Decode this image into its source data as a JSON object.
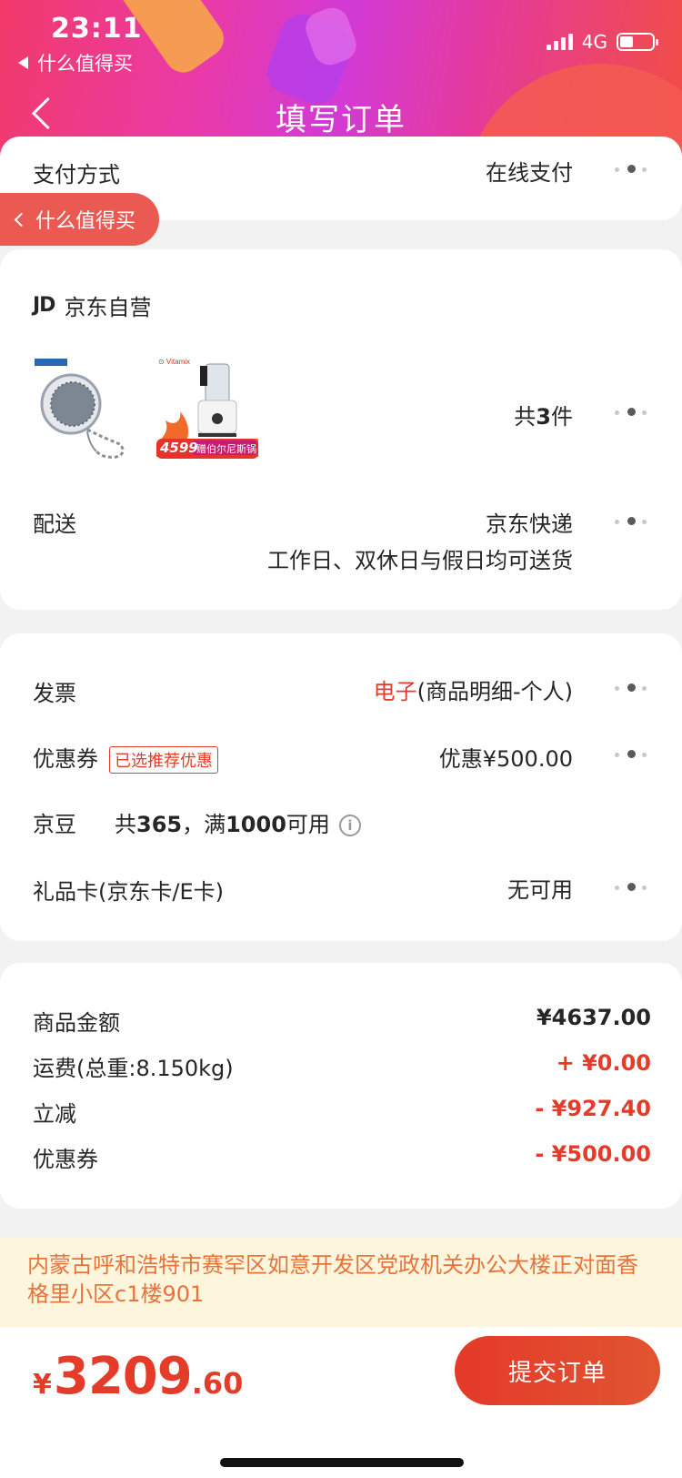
{
  "status": {
    "time": "23:11",
    "back_app": "什么值得买",
    "network": "4G"
  },
  "nav": {
    "title": "填写订单"
  },
  "floating_back": {
    "label": "什么值得买"
  },
  "payment": {
    "label": "支付方式",
    "value": "在线支付"
  },
  "shop": {
    "logo": "JD",
    "name": "京东自营",
    "products": [
      {
        "icon": "tea-infuser-ball"
      },
      {
        "icon": "vitamix-blender",
        "price_badge": "4599",
        "promo": "赠伯尔尼斯锅具"
      }
    ],
    "count_prefix": "共",
    "count": "3",
    "count_suffix": "件",
    "delivery": {
      "label": "配送",
      "method": "京东快递",
      "schedule": "工作日、双休日与假日均可送货"
    }
  },
  "invoice": {
    "label": "发票",
    "type": "电子",
    "detail": "(商品明细-个人)"
  },
  "coupon": {
    "label": "优惠券",
    "tag": "已选推荐优惠",
    "value": "优惠¥500.00"
  },
  "jingdou": {
    "label": "京豆",
    "info_prefix": "共",
    "count": "365",
    "info_mid": "，满",
    "threshold": "1000",
    "info_suffix": "可用"
  },
  "giftcard": {
    "label": "礼品卡(京东卡/E卡)",
    "value": "无可用"
  },
  "summary": {
    "items": [
      {
        "label": "商品金额",
        "value": "¥4637.00"
      },
      {
        "label": "运费(总重:8.150kg)",
        "value": "+ ¥0.00"
      },
      {
        "label": "立减",
        "value": "- ¥927.40"
      },
      {
        "label": "优惠券",
        "value": "- ¥500.00"
      }
    ]
  },
  "address": "内蒙古呼和浩特市赛罕区如意开发区党政机关办公大楼正对面香格里小区c1楼901",
  "total": {
    "currency": "¥",
    "integer": "3209",
    "decimal": ".60"
  },
  "submit_label": "提交订单",
  "colors": {
    "accent_red": "#e43c2a",
    "address_text": "#e8733a",
    "address_bg": "#fdf6dd"
  }
}
